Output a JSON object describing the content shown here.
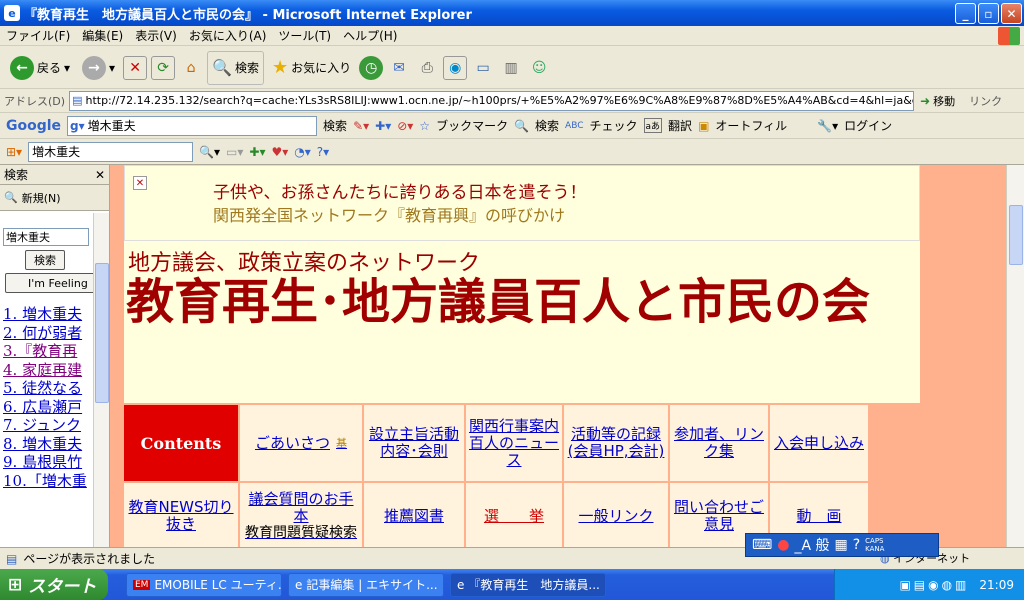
{
  "window": {
    "title": "『教育再生　地方議員百人と市民の会』 - Microsoft Internet Explorer"
  },
  "menu": [
    "ファイル(F)",
    "編集(E)",
    "表示(V)",
    "お気に入り(A)",
    "ツール(T)",
    "ヘルプ(H)"
  ],
  "toolbar": {
    "back": "戻る",
    "search": "検索",
    "favorites": "お気に入り"
  },
  "address": {
    "label": "アドレス(D)",
    "url": "http://72.14.235.132/search?q=cache:YLs3sRS8ILIJ:www1.ocn.ne.jp/~h100prs/+%E5%A2%97%E6%9C%A8%E9%87%8D%E5%A4%AB&cd=4&hl=ja&ct=clnk&gl=jp&lr=lan",
    "go": "移動",
    "links": "リンク"
  },
  "google": {
    "logo": "Google",
    "query": "増木重夫",
    "search": "検索",
    "bookmarks": "ブックマーク",
    "search2": "検索",
    "check": "チェック",
    "translate": "翻訳",
    "autofill": "オートフィル",
    "login": "ログイン"
  },
  "links_bar": {
    "query": "増木重夫"
  },
  "side": {
    "title": "検索",
    "new": "新規(N)",
    "input": "増木重夫",
    "search_button": "検索",
    "lucky_button": "I'm Feeling",
    "results": [
      "1. 増木重夫",
      "2. 何が弱者",
      "3.『教育再",
      "4. 家庭再建",
      "5. 徒然なる",
      "6. 広島瀬戸",
      "7. ジュンク",
      "8. 増木重夫",
      "9. 島根県竹",
      "10.「増木重"
    ]
  },
  "page": {
    "banner1": "子供や、お孫さんたちに誇りある日本を遣そう！",
    "banner2": "関西発全国ネットワーク『教育再興』の呼びかけ",
    "subtitle": "地方議会、政策立案のネットワーク",
    "title": "教育再生･地方議員百人と市民の会",
    "nav": {
      "contents": "Contents",
      "greeting": "ごあいさつ",
      "greeting_mark": "基",
      "purpose": "設立主旨活動内容･会則",
      "kansai": "関西行事案内百人のニュース",
      "records": "活動等の記録(会員HP,会計)",
      "members": "参加者、リンク集",
      "join": "入会申し込み",
      "news": "教育NEWS切り抜き",
      "questions": "議会質問のお手本",
      "questions_sub": "教育問題質疑検索",
      "books": "推薦図書",
      "election": "選　　挙",
      "general_links": "一般リンク",
      "contact": "問い合わせご意見",
      "video": "動　画"
    }
  },
  "status": {
    "text": "ページが表示されました",
    "zone": "インターネット"
  },
  "langbar": {
    "text": "_A 般",
    "caps": "CAPS",
    "kana": "KANA"
  },
  "taskbar": {
    "start": "スタート",
    "items": [
      "EMOBILE LC ユーティ...",
      "記事編集 | エキサイト...",
      "『教育再生　地方議員..."
    ],
    "time": "21:09"
  }
}
